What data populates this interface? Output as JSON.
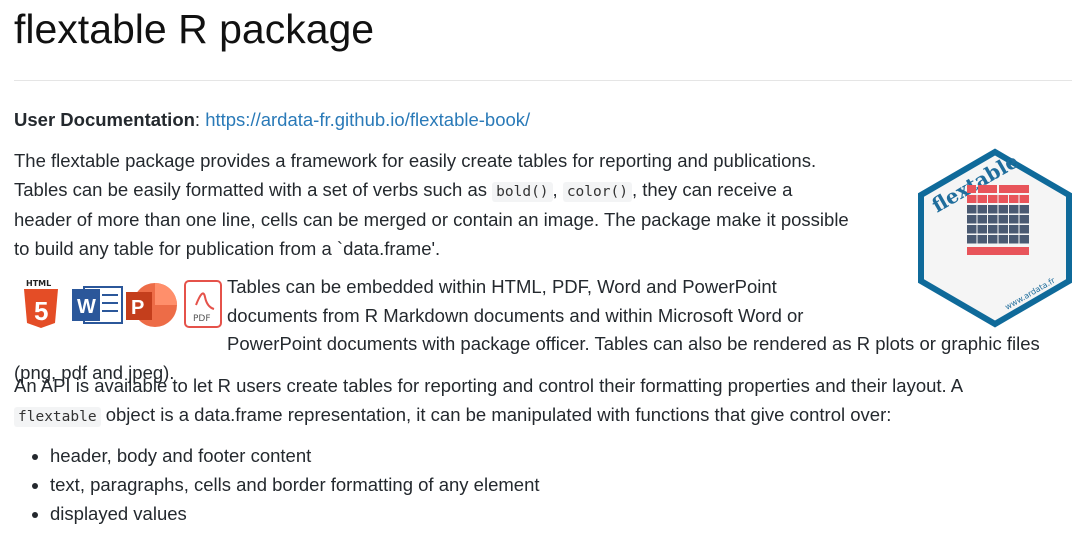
{
  "title": "flextable R package",
  "doc": {
    "label": "User Documentation",
    "sep": ": ",
    "link": "https://ardata-fr.github.io/flextable-book/"
  },
  "p1": {
    "a": "The flextable package provides a framework for easily create tables for reporting and publications.",
    "b": "Tables can be easily formatted with a set of verbs such as ",
    "code1": "bold()",
    "c": ", ",
    "code2": "color()",
    "d": ", they can receive a",
    "e": "header of more than one line, cells can be merged or contain an image. The package make it possible",
    "f": "to build any table for publication from a `data.frame'."
  },
  "p2": {
    "a": "Tables can be embedded within HTML, PDF, Word and PowerPoint",
    "b": "documents from R Markdown documents and within Microsoft Word or",
    "c": "PowerPoint documents with package officer. Tables can also be rendered as R plots or graphic files (png, pdf and jpeg)."
  },
  "p3": {
    "a": "An API is available to let R users create tables for reporting and control their formatting properties and their layout. A",
    "code": "flextable",
    "b": " object is a data.frame representation, it can be manipulated with functions that give control over:"
  },
  "list": [
    "header, body and footer content",
    "text, paragraphs, cells and border formatting of any element",
    "displayed values"
  ],
  "logo": {
    "name": "flextable",
    "site": "www.ardata.fr"
  },
  "icons": {
    "html": "HTML",
    "pdf": "PDF",
    "word": "W",
    "ppt": "P"
  }
}
